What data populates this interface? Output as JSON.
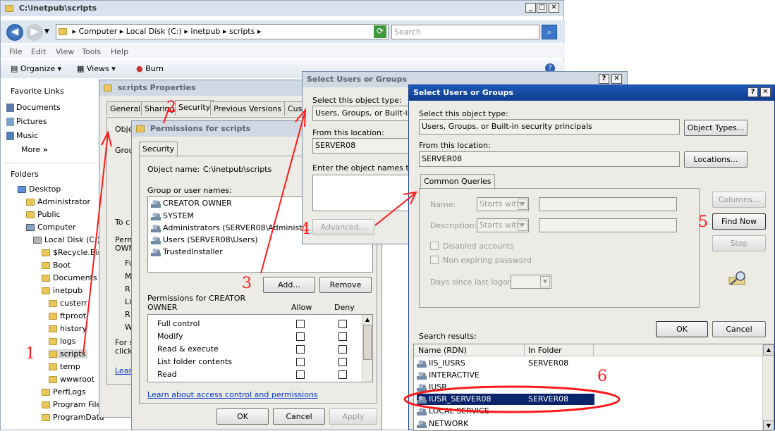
{
  "explorer": {
    "title": "C:\\inetpub\\scripts",
    "breadcrumb": [
      "Computer",
      "Local Disk (C:)",
      "inetpub",
      "scripts"
    ],
    "search_placeholder": "Search",
    "menu": [
      "File",
      "Edit",
      "View",
      "Tools",
      "Help"
    ],
    "toolbar": {
      "organize": "Organize",
      "views": "Views",
      "burn": "Burn"
    },
    "favorites_heading": "Favorite Links",
    "favorites": [
      "Documents",
      "Pictures",
      "Music",
      "More"
    ],
    "folders_heading": "Folders",
    "tree": [
      "Desktop",
      "Administrator",
      "Public",
      "Computer",
      "Local Disk (C:)",
      "$Recycle.Bin",
      "Boot",
      "Documents ar",
      "inetpub",
      "custerr",
      "ftproot",
      "history",
      "logs",
      "scripts",
      "temp",
      "wwwroot",
      "PerfLogs",
      "Program Files",
      "ProgramData"
    ]
  },
  "props": {
    "title": "scripts Properties",
    "tabs": [
      "General",
      "Sharing",
      "Security",
      "Previous Versions",
      "Custo"
    ],
    "fragments": [
      "Obje",
      "Grou",
      "To c",
      "Perm",
      "OWN",
      "Fu",
      "M",
      "R",
      "Li",
      "R",
      "W",
      "For s",
      "click",
      "Lear"
    ]
  },
  "perms": {
    "title": "Permissions for scripts",
    "tab": "Security",
    "object_name_label": "Object name:",
    "object_name_value": "C:\\inetpub\\scripts",
    "group_label": "Group or user names:",
    "users": [
      "CREATOR OWNER",
      "SYSTEM",
      "Administrators (SERVER08\\Administrators)",
      "Users (SERVER08\\Users)",
      "TrustedInstaller"
    ],
    "add": "Add...",
    "remove": "Remove",
    "perm_for_1": "Permissions for CREATOR",
    "perm_for_2": "OWNER",
    "allow": "Allow",
    "deny": "Deny",
    "permissions": [
      "Full control",
      "Modify",
      "Read & execute",
      "List folder contents",
      "Read"
    ],
    "learn": "Learn about access control and permissions",
    "ok": "OK",
    "cancel": "Cancel",
    "apply": "Apply"
  },
  "sel1": {
    "title": "Select Users or Groups",
    "obj_type_label": "Select this object type:",
    "obj_type_value": "Users, Groups, or Built-in secu",
    "loc_label": "From this location:",
    "loc_value": "SERVER08",
    "enter_label": "Enter the object names to sel",
    "advanced": "Advanced..."
  },
  "sel2": {
    "title": "Select Users or Groups",
    "obj_type_label": "Select this object type:",
    "obj_type_value": "Users, Groups, or Built-in security principals",
    "object_types_btn": "Object Types...",
    "loc_label": "From this location:",
    "loc_value": "SERVER08",
    "locations_btn": "Locations...",
    "tab": "Common Queries",
    "name_label": "Name:",
    "desc_label": "Description:",
    "starts_with": "Starts with",
    "disabled_accounts": "Disabled accounts",
    "non_expiring": "Non expiring password",
    "days_label": "Days since last logon:",
    "columns_btn": "Columns...",
    "find_now_btn": "Find Now",
    "stop_btn": "Stop",
    "ok": "OK",
    "cancel": "Cancel",
    "search_results": "Search results:",
    "col_name": "Name (RDN)",
    "col_folder": "In Folder",
    "rows": [
      {
        "name": "IIS_IUSRS",
        "folder": "SERVER08"
      },
      {
        "name": "INTERACTIVE",
        "folder": ""
      },
      {
        "name": "IUSR",
        "folder": ""
      },
      {
        "name": "IUSR_SERVER08",
        "folder": "SERVER08"
      },
      {
        "name": "LOCAL SERVICE",
        "folder": ""
      },
      {
        "name": "NETWORK",
        "folder": ""
      }
    ]
  },
  "annotations": [
    "1",
    "2",
    "3",
    "4",
    "5",
    "6"
  ],
  "colors": {
    "annotation": "#ff1a1a",
    "selection": "#0a246a",
    "title_active": "#1c58b8"
  }
}
